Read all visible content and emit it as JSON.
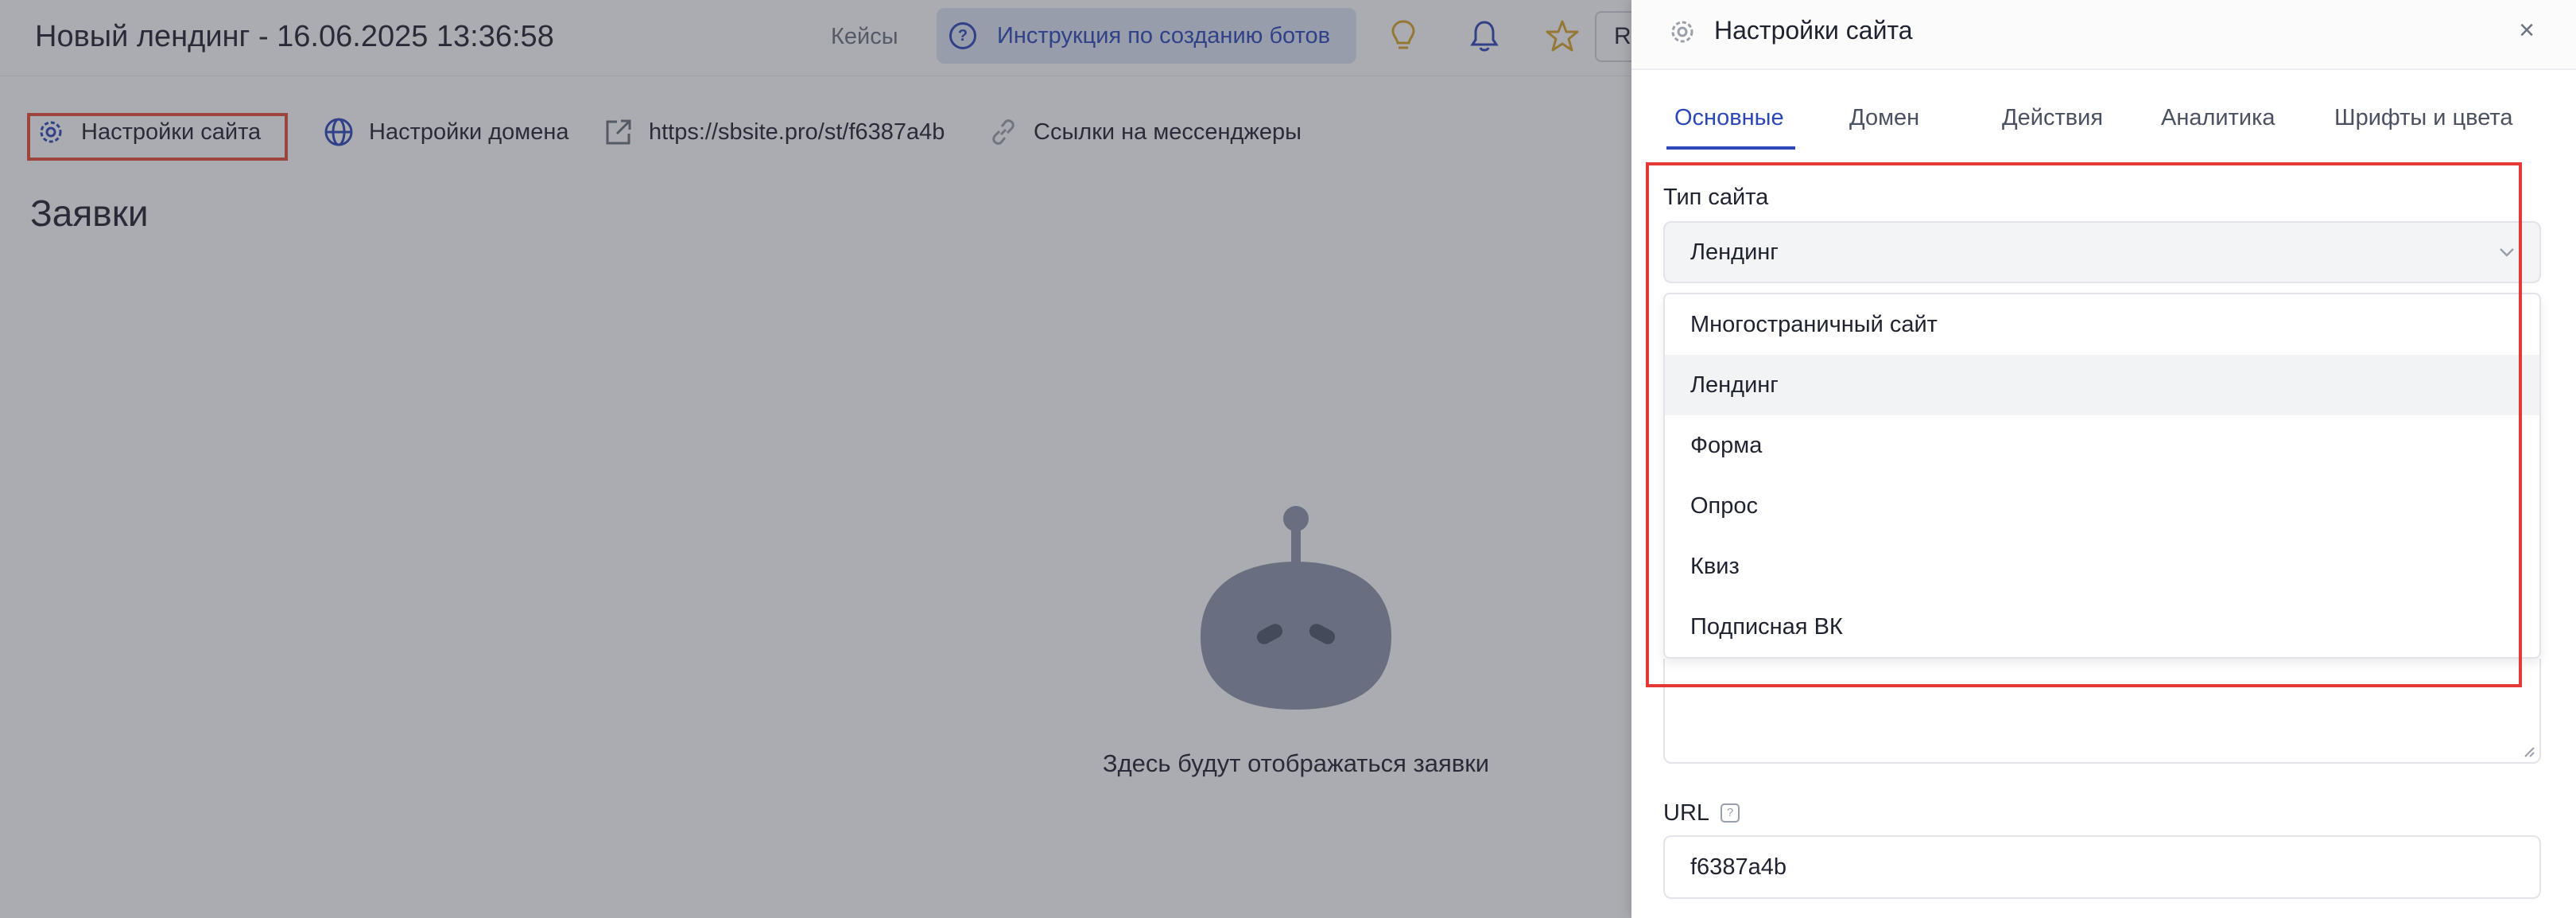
{
  "header": {
    "title": "Новый лендинг - 16.06.2025 13:36:58",
    "cases_link": "Кейсы",
    "guide_button": "Инструкция по созданию ботов",
    "partial_button": "R"
  },
  "subnav": {
    "site_settings": "Настройки сайта",
    "domain_settings": "Настройки домена",
    "site_url": "https://sbsite.pro/st/f6387a4b",
    "messenger_links": "Ссылки на мессенджеры"
  },
  "main": {
    "section_title": "Заявки",
    "empty_text": "Здесь будут отображаться заявки"
  },
  "drawer": {
    "title": "Настройки сайта",
    "close": "×",
    "tabs": [
      {
        "label": "Основные",
        "active": true
      },
      {
        "label": "Домен",
        "active": false
      },
      {
        "label": "Действия",
        "active": false
      },
      {
        "label": "Аналитика",
        "active": false
      },
      {
        "label": "Шрифты и цвета",
        "active": false
      }
    ],
    "site_type": {
      "label": "Тип сайта",
      "value": "Лендинг",
      "options": [
        {
          "label": "Многостраничный сайт",
          "selected": false
        },
        {
          "label": "Лендинг",
          "selected": true
        },
        {
          "label": "Форма",
          "selected": false
        },
        {
          "label": "Опрос",
          "selected": false
        },
        {
          "label": "Квиз",
          "selected": false
        },
        {
          "label": "Подписная ВК",
          "selected": false
        }
      ]
    },
    "url_field": {
      "label": "URL",
      "help": "?",
      "value": "f6387a4b"
    }
  },
  "colors": {
    "accent": "#2c47b8",
    "highlight_red": "#e53935",
    "lightbulb": "#d9a62a",
    "star": "#d9a62a"
  },
  "icons": [
    "question-icon",
    "lightbulb-icon",
    "bell-icon",
    "star-icon",
    "gear-icon",
    "globe-icon",
    "external-link-icon",
    "link-icon",
    "robot-icon",
    "chevron-down-icon",
    "close-icon",
    "help-icon"
  ]
}
